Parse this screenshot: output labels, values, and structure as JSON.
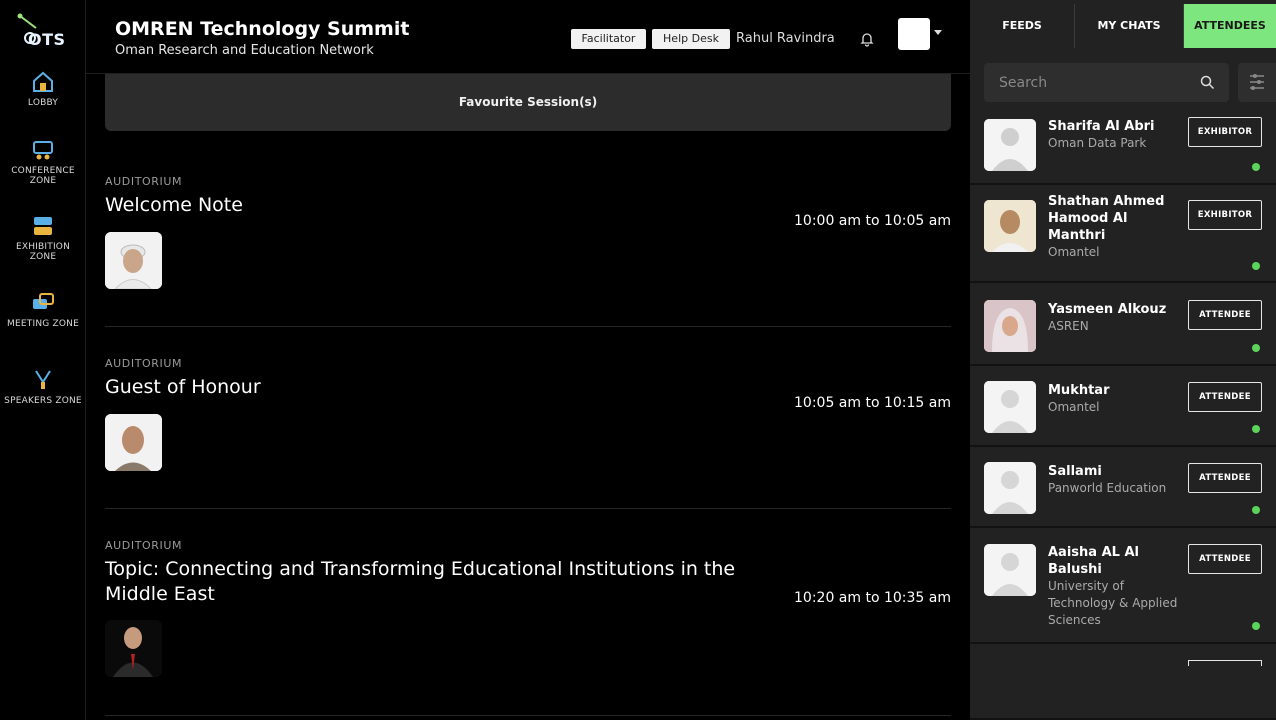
{
  "app": {
    "logo_text": "OTS",
    "event_title": "OMREN Technology Summit",
    "event_subtitle": "Oman Research and Education Network"
  },
  "sidebar": {
    "items": [
      {
        "label": "LOBBY",
        "icon": "home-icon"
      },
      {
        "label": "CONFERENCE ZONE",
        "icon": "conference-icon"
      },
      {
        "label": "EXHIBITION ZONE",
        "icon": "exhibition-icon"
      },
      {
        "label": "MEETING ZONE",
        "icon": "meeting-icon"
      },
      {
        "label": "SPEAKERS ZONE",
        "icon": "speakers-icon"
      }
    ]
  },
  "header": {
    "facilitator_label": "Facilitator",
    "help_label": "Help Desk",
    "user_name": "Rahul Ravindra"
  },
  "main": {
    "favourite_label": "Favourite Session(s)",
    "sessions": [
      {
        "venue": "AUDITORIUM",
        "title": "Welcome Note",
        "time": "10:00 am to 10:05 am"
      },
      {
        "venue": "AUDITORIUM",
        "title": "Guest of Honour",
        "time": "10:05 am to 10:15 am"
      },
      {
        "venue": "AUDITORIUM",
        "title": "Topic: Connecting and Transforming Educational Institutions in the Middle East",
        "time": "10:20 am to 10:35 am"
      }
    ]
  },
  "right_panel": {
    "tabs": [
      {
        "label": "FEEDS"
      },
      {
        "label": "MY CHATS"
      },
      {
        "label": "ATTENDEES"
      }
    ],
    "active_tab": "ATTENDEES",
    "search_placeholder": "Search",
    "attendees": [
      {
        "name": "Sharifa Al Abri",
        "org": "Oman Data Park",
        "role": "EXHIBITOR",
        "online": true
      },
      {
        "name": "Shathan Ahmed Hamood Al Manthri",
        "org": "Omantel",
        "role": "EXHIBITOR",
        "online": true
      },
      {
        "name": "Yasmeen Alkouz",
        "org": "ASREN",
        "role": "ATTENDEE",
        "online": true
      },
      {
        "name": "Mukhtar",
        "org": "Omantel",
        "role": "ATTENDEE",
        "online": true
      },
      {
        "name": "Sallami",
        "org": "Panworld Education",
        "role": "ATTENDEE",
        "online": true
      },
      {
        "name": "Aaisha AL Al Balushi",
        "org": "University of Technology & Applied Sciences",
        "role": "ATTENDEE",
        "online": true
      }
    ]
  },
  "colors": {
    "accent_green": "#7ee67e",
    "online_green": "#5cd45c",
    "panel_bg": "#222222"
  }
}
